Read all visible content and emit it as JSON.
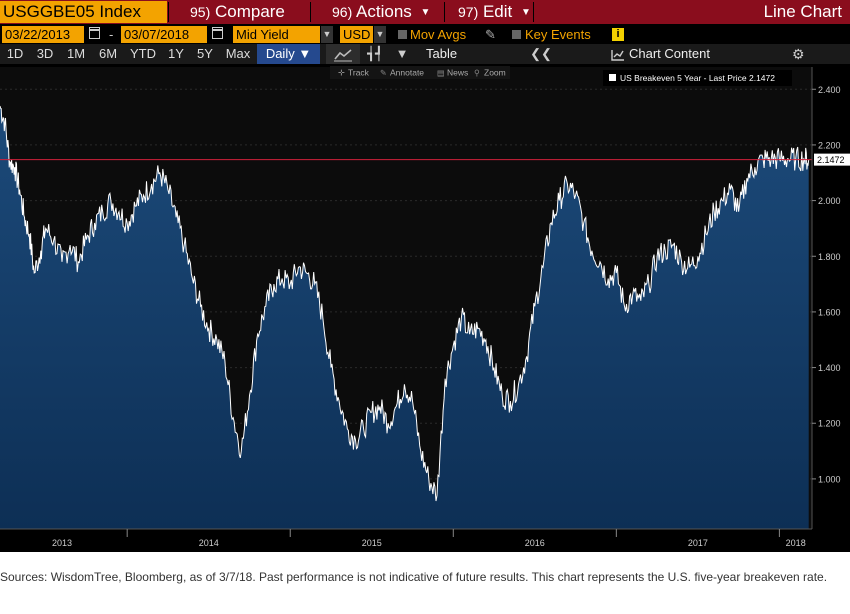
{
  "toolbar": {
    "ticker": "USGGBE05 Index",
    "compare": {
      "num": "95)",
      "label": "Compare"
    },
    "actions": {
      "num": "96)",
      "label": "Actions"
    },
    "edit": {
      "num": "97)",
      "label": "Edit"
    },
    "view_title": "Line Chart"
  },
  "params": {
    "start_date": "03/22/2013",
    "range_sep": "-",
    "end_date": "03/07/2018",
    "field": "Mid Yield",
    "currency": "USD",
    "mov_avgs": "Mov Avgs",
    "key_events": "Key Events"
  },
  "ranges": [
    "1D",
    "3D",
    "1M",
    "6M",
    "YTD",
    "1Y",
    "5Y",
    "Max"
  ],
  "frequency": "Daily ▼",
  "table_label": "Table",
  "chart_content": "Chart Content",
  "tools": {
    "track": "Track",
    "annotate": "Annotate",
    "news": "News",
    "zoom": "Zoom"
  },
  "colors": {
    "accent": "#f3a300",
    "header": "#8a0d1d",
    "last_line": "#d0213b",
    "area": "#0d2f55",
    "line": "#ffffff"
  },
  "chart_data": {
    "type": "area",
    "legend": "US Breakeven 5 Year - Last Price 2.1472",
    "last_value": 2.1472,
    "last_label": "2.1472",
    "ylim": [
      0.82,
      2.48
    ],
    "y_ticks": [
      1.0,
      1.2,
      1.4,
      1.6,
      1.8,
      2.0,
      2.2,
      2.4
    ],
    "y_tick_labels": [
      "1.000",
      "1.200",
      "1.400",
      "1.600",
      "1.800",
      "2.000",
      "2.200",
      "2.400"
    ],
    "x_range": [
      2013.22,
      2018.2
    ],
    "x_tick_labels": [
      {
        "label": "2013",
        "x": 2013.6
      },
      {
        "label": "2014",
        "x": 2014.5
      },
      {
        "label": "2015",
        "x": 2015.5
      },
      {
        "label": "2016",
        "x": 2016.5
      },
      {
        "label": "2017",
        "x": 2017.5
      },
      {
        "label": "2018",
        "x": 2018.1
      }
    ],
    "year_separators": [
      2014.0,
      2015.0,
      2016.0,
      2017.0,
      2018.0
    ],
    "x": [
      2013.22,
      2013.25,
      2013.28,
      2013.31,
      2013.34,
      2013.37,
      2013.4,
      2013.43,
      2013.47,
      2013.5,
      2013.55,
      2013.6,
      2013.65,
      2013.7,
      2013.75,
      2013.8,
      2013.85,
      2013.9,
      2013.95,
      2014.0,
      2014.05,
      2014.1,
      2014.15,
      2014.2,
      2014.25,
      2014.3,
      2014.35,
      2014.4,
      2014.45,
      2014.5,
      2014.55,
      2014.6,
      2014.65,
      2014.7,
      2014.75,
      2014.8,
      2014.85,
      2014.9,
      2014.95,
      2015.0,
      2015.05,
      2015.1,
      2015.15,
      2015.2,
      2015.25,
      2015.3,
      2015.35,
      2015.4,
      2015.45,
      2015.5,
      2015.55,
      2015.6,
      2015.65,
      2015.7,
      2015.75,
      2015.8,
      2015.85,
      2015.9,
      2015.95,
      2016.0,
      2016.05,
      2016.1,
      2016.15,
      2016.2,
      2016.25,
      2016.3,
      2016.35,
      2016.4,
      2016.45,
      2016.5,
      2016.55,
      2016.6,
      2016.65,
      2016.7,
      2016.75,
      2016.8,
      2016.85,
      2016.9,
      2016.95,
      2017.0,
      2017.05,
      2017.1,
      2017.15,
      2017.2,
      2017.25,
      2017.3,
      2017.35,
      2017.4,
      2017.45,
      2017.5,
      2017.55,
      2017.6,
      2017.65,
      2017.7,
      2017.75,
      2017.8,
      2017.85,
      2017.9,
      2017.95,
      2018.0,
      2018.05,
      2018.1,
      2018.15,
      2018.18
    ],
    "values": [
      2.34,
      2.28,
      2.14,
      2.12,
      2.04,
      1.94,
      1.88,
      1.74,
      1.82,
      1.9,
      1.86,
      1.78,
      1.84,
      1.78,
      1.86,
      1.92,
      1.96,
      2.0,
      1.96,
      1.92,
      1.98,
      2.02,
      2.06,
      2.1,
      2.04,
      1.94,
      1.84,
      1.72,
      1.62,
      1.54,
      1.5,
      1.42,
      1.22,
      1.1,
      1.3,
      1.52,
      1.62,
      1.7,
      1.72,
      1.7,
      1.76,
      1.74,
      1.7,
      1.58,
      1.4,
      1.28,
      1.18,
      1.14,
      1.18,
      1.24,
      1.26,
      1.2,
      1.26,
      1.34,
      1.28,
      1.1,
      1.0,
      0.94,
      1.36,
      1.48,
      1.58,
      1.52,
      1.54,
      1.5,
      1.4,
      1.3,
      1.28,
      1.34,
      1.44,
      1.62,
      1.76,
      1.92,
      2.0,
      2.06,
      2.02,
      1.92,
      1.82,
      1.78,
      1.72,
      1.74,
      1.62,
      1.66,
      1.64,
      1.7,
      1.8,
      1.82,
      1.84,
      1.78,
      1.76,
      1.8,
      1.88,
      1.96,
      2.0,
      2.04,
      1.96,
      2.08,
      2.12,
      2.15,
      2.15,
      2.15,
      2.15,
      2.15,
      2.15,
      2.1472
    ]
  },
  "caption": "Sources: WisdomTree, Bloomberg, as of 3/7/18. Past performance is not indicative of future results. This chart represents the U.S. five-year breakeven rate."
}
